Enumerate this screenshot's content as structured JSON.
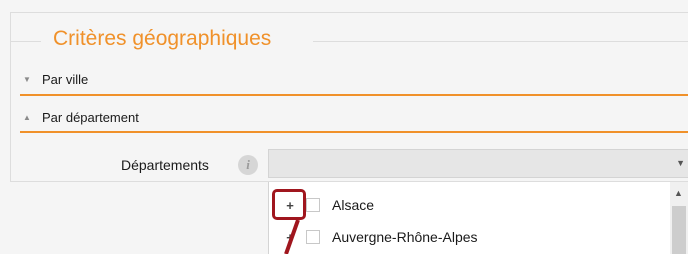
{
  "panel": {
    "title": "Critères géographiques"
  },
  "sections": {
    "ville_label": "Par ville",
    "ville_toggle_icon": "triangle-down-icon",
    "departement_label": "Par département",
    "departement_toggle_icon": "triangle-up-icon"
  },
  "departements": {
    "label": "Départements",
    "info_icon": "i",
    "selected_value": "",
    "options": [
      {
        "expand": "+",
        "label": "Alsace"
      },
      {
        "expand": "+",
        "label": "Auvergne-Rhône-Alpes"
      }
    ]
  },
  "colors": {
    "accent": "#f0912a",
    "highlight": "#a0161e"
  }
}
